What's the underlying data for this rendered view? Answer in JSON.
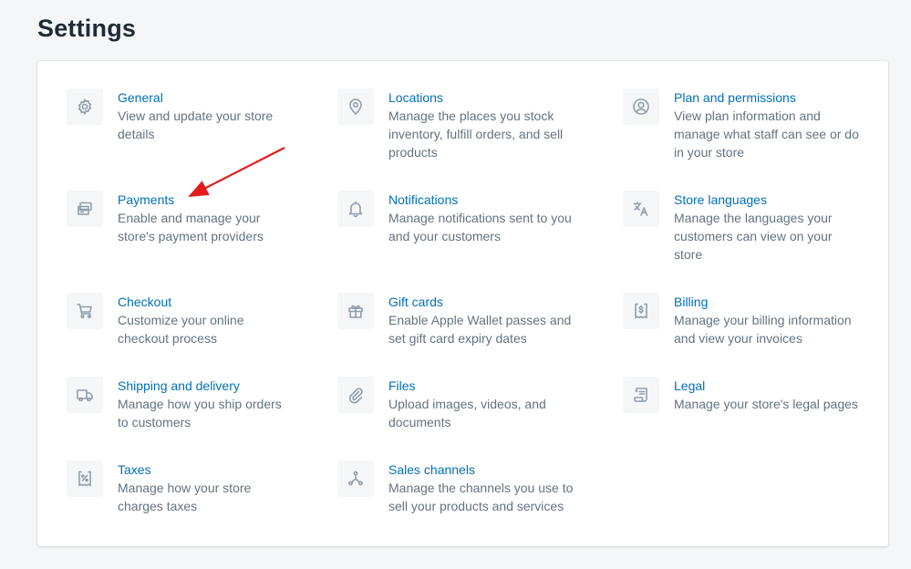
{
  "page": {
    "title": "Settings"
  },
  "settings": {
    "general": {
      "icon": "gear-icon",
      "title": "General",
      "desc": "View and update your store details"
    },
    "locations": {
      "icon": "location-pin-icon",
      "title": "Locations",
      "desc": "Manage the places you stock inventory, fulfill orders, and sell products"
    },
    "plan": {
      "icon": "user-circle-icon",
      "title": "Plan and permissions",
      "desc": "View plan information and manage what staff can see or do in your store"
    },
    "payments": {
      "icon": "payment-cards-icon",
      "title": "Payments",
      "desc": "Enable and manage your store's payment providers"
    },
    "notifications": {
      "icon": "bell-icon",
      "title": "Notifications",
      "desc": "Manage notifications sent to you and your customers"
    },
    "languages": {
      "icon": "translate-icon",
      "title": "Store languages",
      "desc": "Manage the languages your customers can view on your store"
    },
    "checkout": {
      "icon": "cart-icon",
      "title": "Checkout",
      "desc": "Customize your online checkout process"
    },
    "gift_cards": {
      "icon": "gift-icon",
      "title": "Gift cards",
      "desc": "Enable Apple Wallet passes and set gift card expiry dates"
    },
    "billing": {
      "icon": "receipt-dollar-icon",
      "title": "Billing",
      "desc": "Manage your billing information and view your invoices"
    },
    "shipping": {
      "icon": "truck-icon",
      "title": "Shipping and delivery",
      "desc": "Manage how you ship orders to customers"
    },
    "files": {
      "icon": "paperclip-icon",
      "title": "Files",
      "desc": "Upload images, videos, and documents"
    },
    "legal": {
      "icon": "document-icon",
      "title": "Legal",
      "desc": "Manage your store's legal pages"
    },
    "taxes": {
      "icon": "receipt-percent-icon",
      "title": "Taxes",
      "desc": "Manage how your store charges taxes"
    },
    "sales_channels": {
      "icon": "channels-icon",
      "title": "Sales channels",
      "desc": "Manage the channels you use to sell your products and services"
    }
  },
  "annotation": {
    "color": "#e31b1b",
    "points_to": "Payments"
  },
  "colors": {
    "link": "#006fbb",
    "subdued": "#637381",
    "icon": "#919eab",
    "background": "#f4f6f8"
  }
}
